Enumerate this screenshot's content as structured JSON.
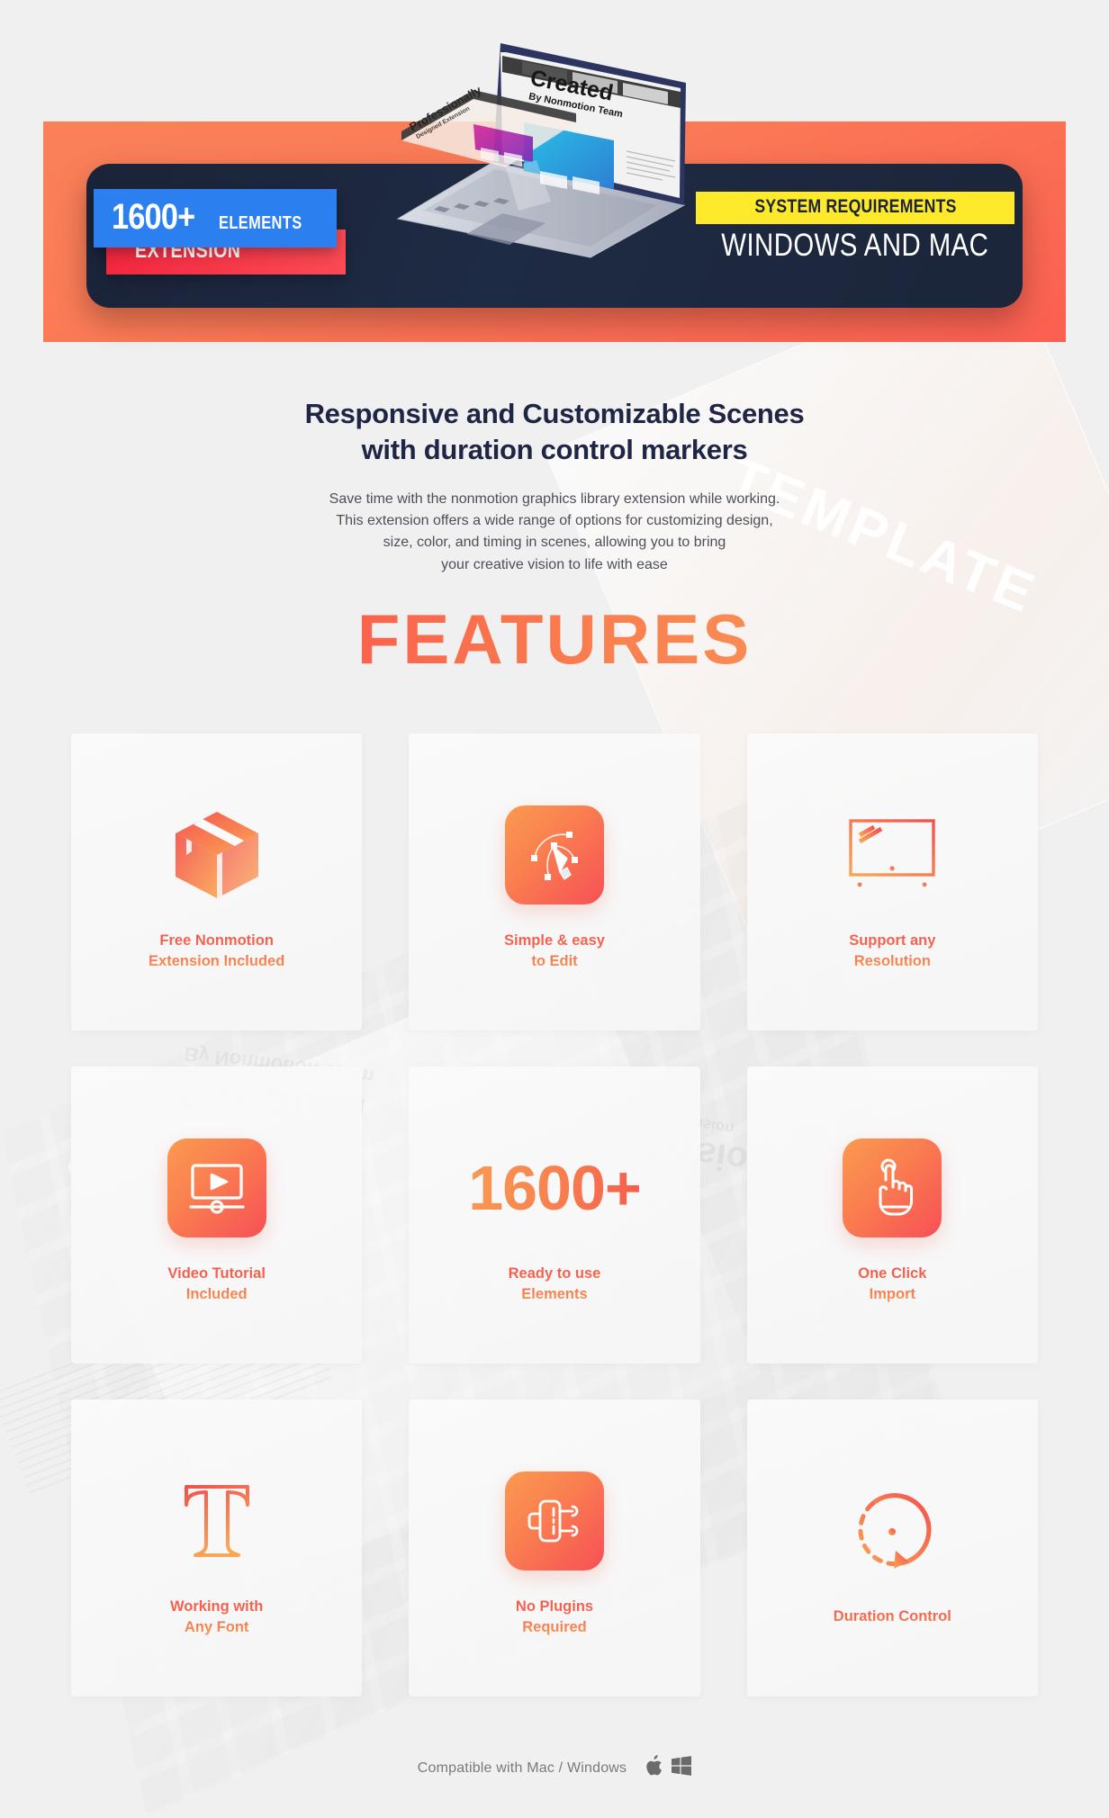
{
  "hero": {
    "badge_count_number": "1600+",
    "badge_count_label": "ELEMENTS",
    "badge_extension": "EXTENSION",
    "system_requirements_label": "SYSTEM REQUIREMENTS",
    "system_os": "WINDOWS AND MAC",
    "laptop_screen_title": "Created",
    "laptop_screen_subtitle": "By Nonmotion Team",
    "laptop_back_title": "Professionally",
    "laptop_back_subtitle": "Designed Extension"
  },
  "intro": {
    "title_line1": "Responsive and Customizable Scenes",
    "title_line2": "with duration control markers",
    "body_line1": "Save time with the nonmotion graphics library extension while working.",
    "body_line2": "This extension offers a wide range of options for customizing design,",
    "body_line3": "size, color, and timing in scenes, allowing you to bring",
    "body_line4": "your creative vision to life with ease"
  },
  "section": {
    "features_heading": "FEATURES"
  },
  "features": [
    {
      "icon": "package-box-icon",
      "style": "plain",
      "line1": "Free Nonmotion",
      "line2": "Extension Included"
    },
    {
      "icon": "pen-tool-icon",
      "style": "tile",
      "line1": "Simple & easy",
      "line2": "to Edit"
    },
    {
      "icon": "monitor-icon",
      "style": "plain",
      "line1": "Support any",
      "line2": "Resolution"
    },
    {
      "icon": "video-player-icon",
      "style": "tile",
      "line1": "Video Tutorial",
      "line2": "Included"
    },
    {
      "icon": "number-icon",
      "style": "number",
      "number": "1600+",
      "line1": "Ready to use",
      "line2": "Elements"
    },
    {
      "icon": "click-hand-icon",
      "style": "tile",
      "line1": "One Click",
      "line2": "Import"
    },
    {
      "icon": "text-type-icon",
      "style": "plain",
      "line1": "Working with",
      "line2": "Any Font"
    },
    {
      "icon": "power-plug-icon",
      "style": "tile",
      "line1": "No Plugins",
      "line2": "Required"
    },
    {
      "icon": "clock-duration-icon",
      "style": "plain",
      "line1": "Duration Control",
      "line2": ""
    }
  ],
  "footer": {
    "text": "Compatible with Mac / Windows",
    "apple_icon": "apple-logo-icon",
    "windows_icon": "windows-logo-icon"
  },
  "background": {
    "watermark_template": "TEMPLATE",
    "watermark_created": "Created",
    "watermark_created_sub": "By Nonmotion Team",
    "watermark_prof": "Professionally",
    "watermark_prof_sub": "Designed Extension"
  },
  "colors": {
    "accent_red": "#f4564e",
    "accent_orange": "#f9a154",
    "hero_bg": "#fb7a56",
    "hero_panel": "#1e2b44",
    "badge_blue": "#2b7fef",
    "badge_red": "#f2273f",
    "badge_yellow": "#ffe92b",
    "page_bg": "#f0f0f0"
  }
}
